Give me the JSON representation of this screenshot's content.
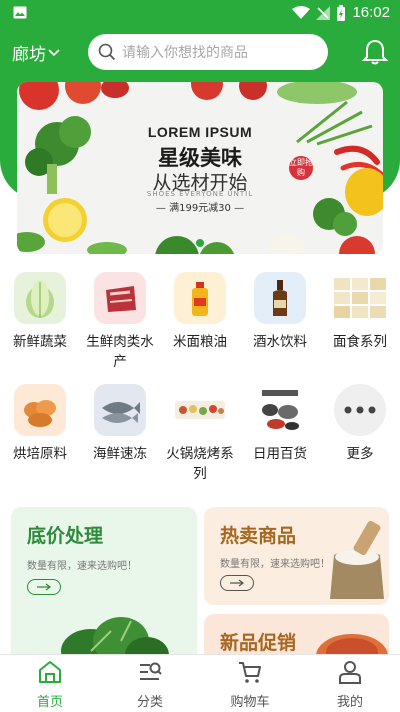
{
  "status_bar": {
    "time": "16:02"
  },
  "header": {
    "city": "廊坊",
    "search_placeholder": "请输入你想找的商品"
  },
  "banner": {
    "line1": "LOREM IPSUM",
    "line2": "星级美味",
    "line3": "从选材开始",
    "line4": "SHOES EVERYONE UNTIL",
    "promo": "满199元减30",
    "badge": "立即抢购"
  },
  "categories": [
    {
      "label": "新鲜蔬菜",
      "icon": "cabbage-icon"
    },
    {
      "label": "生鲜肉类水产",
      "icon": "meat-icon"
    },
    {
      "label": "米面粮油",
      "icon": "oil-bottle-icon"
    },
    {
      "label": "酒水饮料",
      "icon": "liquor-bottle-icon"
    },
    {
      "label": "面食系列",
      "icon": "dumplings-icon"
    },
    {
      "label": "烘培原料",
      "icon": "bread-icon"
    },
    {
      "label": "海鲜速冻",
      "icon": "fish-icon"
    },
    {
      "label": "火锅烧烤系列",
      "icon": "hotpot-icon"
    },
    {
      "label": "日用百货",
      "icon": "cookware-icon"
    },
    {
      "label": "更多",
      "icon": "more-icon"
    }
  ],
  "promos": {
    "lowprice": {
      "title": "底价处理",
      "subtitle": "数量有限，速来选购吧！"
    },
    "hot": {
      "title": "热卖商品",
      "subtitle": "数量有限，速来选购吧！"
    },
    "newpromo": {
      "title": "新品促销"
    }
  },
  "bottom_nav": [
    {
      "label": "首页",
      "icon": "home-icon",
      "active": true
    },
    {
      "label": "分类",
      "icon": "category-icon",
      "active": false
    },
    {
      "label": "购物车",
      "icon": "cart-icon",
      "active": false
    },
    {
      "label": "我的",
      "icon": "user-icon",
      "active": false
    }
  ],
  "colors": {
    "brand": "#2aac3c",
    "lowprice_bg": "#e9f6ea",
    "hot_bg": "#fbeee0"
  }
}
